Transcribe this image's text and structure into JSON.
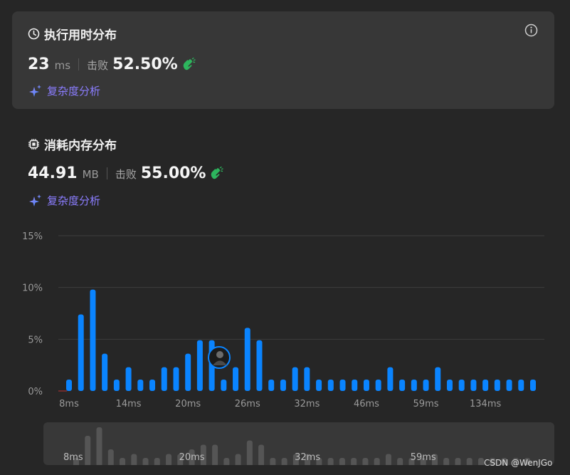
{
  "runtime": {
    "title": "执行用时分布",
    "value": "23",
    "unit": "ms",
    "beats_label": "击败",
    "beats_pct": "52.50%",
    "analysis_label": "复杂度分析"
  },
  "memory": {
    "title": "消耗内存分布",
    "value": "44.91",
    "unit": "MB",
    "beats_label": "击败",
    "beats_pct": "55.00%",
    "analysis_label": "复杂度分析"
  },
  "colors": {
    "accent_blue": "#0a84ff",
    "success_green": "#2db55d",
    "analysis_purple": "#8b7dff",
    "card_bg": "#373737",
    "page_bg": "#262626"
  },
  "chart_data": {
    "type": "bar",
    "ylabel": "",
    "xlabel": "",
    "ylim": [
      0,
      15
    ],
    "y_ticks": [
      "15%",
      "10%",
      "5%",
      "0%"
    ],
    "x_tick_labels": [
      "8ms",
      "14ms",
      "20ms",
      "26ms",
      "32ms",
      "46ms",
      "59ms",
      "134ms"
    ],
    "x_tick_positions_index": [
      0,
      5,
      10,
      15,
      20,
      25,
      30,
      35
    ],
    "values": [
      1.1,
      7.4,
      9.8,
      3.6,
      1.1,
      2.3,
      1.1,
      1.1,
      2.3,
      2.3,
      3.6,
      4.9,
      4.9,
      1.1,
      2.3,
      6.1,
      4.9,
      1.1,
      1.1,
      2.3,
      2.3,
      1.1,
      1.1,
      1.1,
      1.1,
      1.1,
      1.1,
      2.3,
      1.1,
      1.1,
      1.1,
      2.3,
      1.1,
      1.1,
      1.1,
      1.1,
      1.1,
      1.1,
      1.1,
      1.1
    ],
    "highlight_index": 13,
    "grid": true
  },
  "mini_chart": {
    "labels": [
      "8ms",
      "20ms",
      "32ms",
      "59ms"
    ],
    "label_positions_index": [
      0,
      10,
      20,
      30
    ]
  },
  "watermark": "CSDN @WenJGo"
}
